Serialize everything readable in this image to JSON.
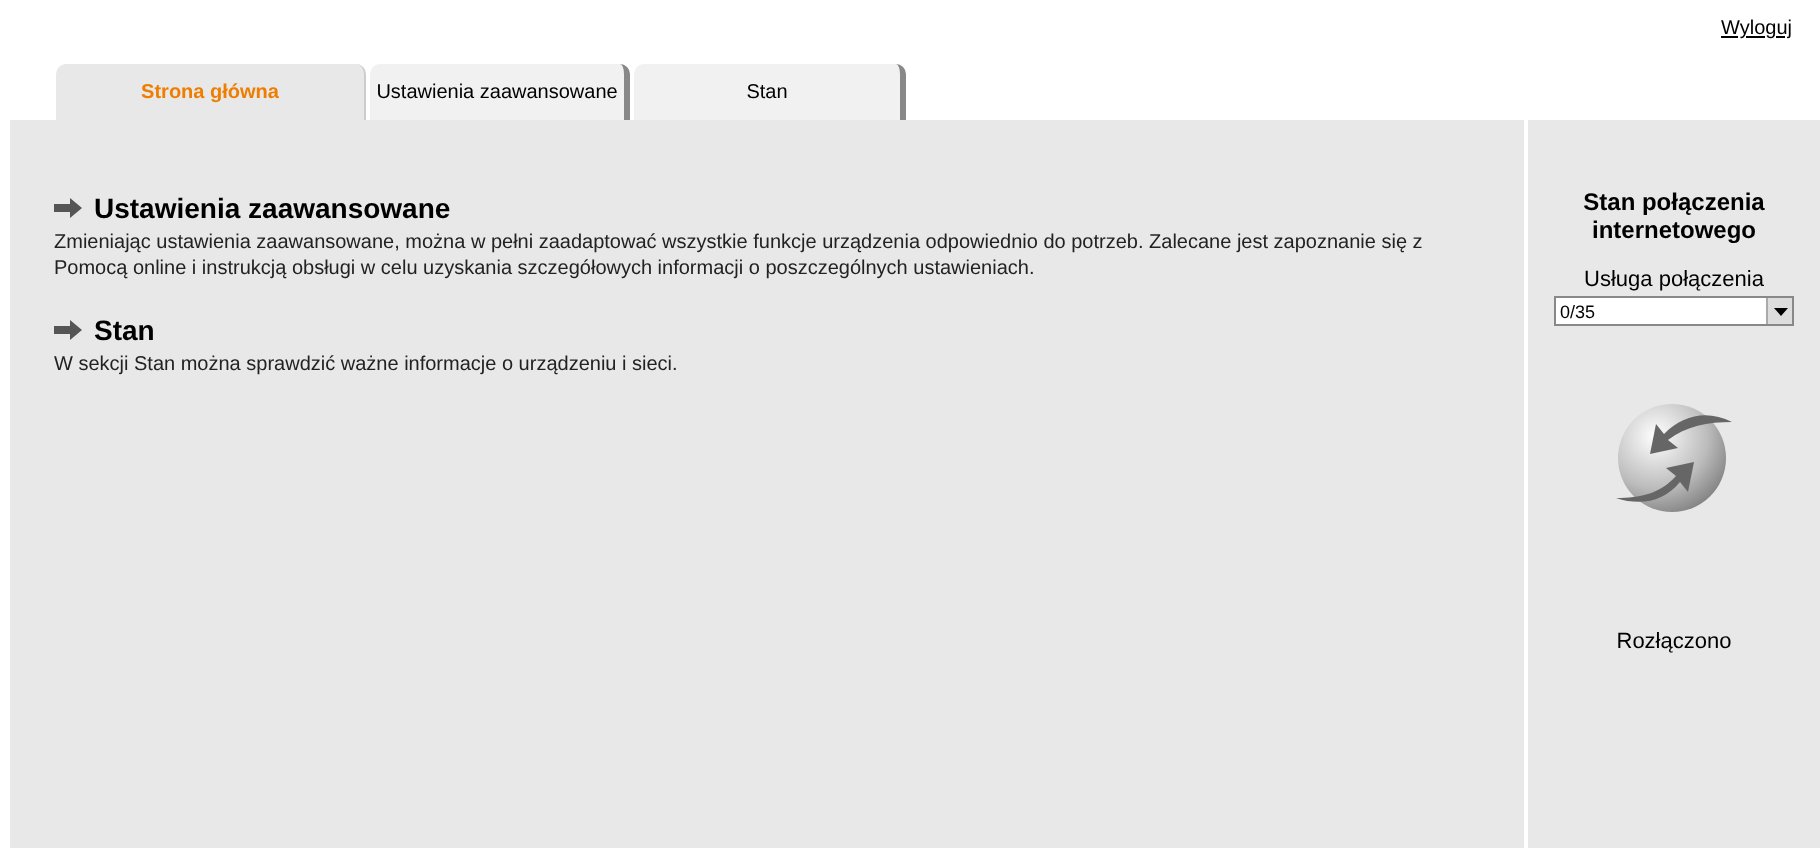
{
  "logout": "Wyloguj",
  "tabs": [
    {
      "label": "Strona główna",
      "selected": true
    },
    {
      "label": "Ustawienia zaawansowane",
      "selected": false
    },
    {
      "label": "Stan",
      "selected": false
    }
  ],
  "sections": [
    {
      "title": "Ustawienia zaawansowane",
      "text": "Zmieniając ustawienia zaawansowane, można w pełni zaadaptować wszystkie funkcje urządzenia odpowiednio do potrzeb. Zalecane jest zapoznanie się z Pomocą online i instrukcją obsługi w celu uzyskania szczegółowych informacji o poszczególnych ustawieniach."
    },
    {
      "title": "Stan",
      "text": "W sekcji Stan można sprawdzić ważne informacje o urządzeniu i sieci."
    }
  ],
  "sidebar": {
    "title": "Stan połączenia internetowego",
    "service_label": "Usługa połączenia",
    "service_value": "0/35",
    "status": "Rozłączono"
  }
}
